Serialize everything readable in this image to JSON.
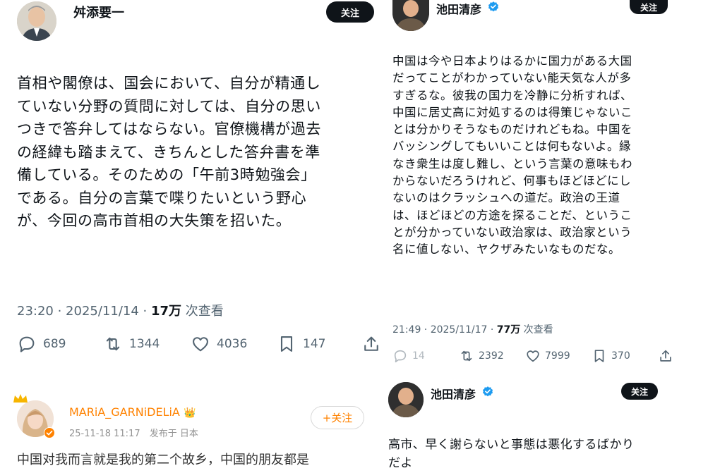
{
  "left_post": {
    "author": "舛添要一",
    "follow_label": "关注",
    "body": "首相や閣僚は、国会において、自分が精通し\nていない分野の質問に対しては、自分の思い\nつきで答弁してはならない。官僚機構が過去\nの経緯も踏まえて、きちんとした答弁書を準\n備している。そのための「午前3時勉強会」\nである。自分の言葉で喋りたいという野心\nが、今回の高市首相の大失策を招いた。",
    "time": "23:20 · 2025/11/14 · ",
    "views_count": "17万",
    "views_suffix": " 次查看",
    "replies": "689",
    "reposts": "1344",
    "likes": "4036",
    "bookmarks": "147"
  },
  "right_post": {
    "author": "池田清彦",
    "follow_label": "关注",
    "body": "中国は今や日本よりはるかに国力がある大国\nだってことがわかっていない能天気な人が多\nすぎるな。彼我の国力を冷静に分析すれば、\n中国に居丈高に対処するのは得策じゃないこ\nとは分かりそうなものだけれどもね。中国を\nバッシングしてもいいことは何もないよ。縁\nなき衆生は度し難し、という言葉の意味もわ\nからないだろうけれど、何事もほどほどにし\nないのはクラッシュへの道だ。政治の王道\nは、ほどほどの方途を探ることだ、というこ\nとが分かっていない政治家は、政治家という\n名に値しない、ヤクザみたいなものだな。",
    "time": "21:49 · 2025/11/17 · ",
    "views_count": "77万",
    "views_suffix": " 次查看",
    "replies": "14",
    "reposts": "2392",
    "likes": "7999",
    "bookmarks": "370"
  },
  "right_post_2": {
    "author": "池田清彦",
    "follow_label": "关注",
    "body": "高市、早く謝らないと事態は悪化するばかり\nだよ"
  },
  "weibo_post": {
    "author": "MARiA_GARNiDELiA",
    "badge_emoji": "👑",
    "time": "25-11-18 11:17",
    "source": "发布于 日本",
    "follow_label": "+关注",
    "body": "中国对我而言就是我的第二个故乡，中国的朋友都是"
  },
  "colors": {
    "text": "#0f1419",
    "secondary": "#536471",
    "verified": "#1d9bf0",
    "weibo_name": "#ff8200",
    "weibo_follow": "#ff8200"
  },
  "icons": [
    "reply-icon",
    "repost-icon",
    "like-icon",
    "bookmark-icon",
    "share-icon",
    "verified-badge-icon"
  ]
}
